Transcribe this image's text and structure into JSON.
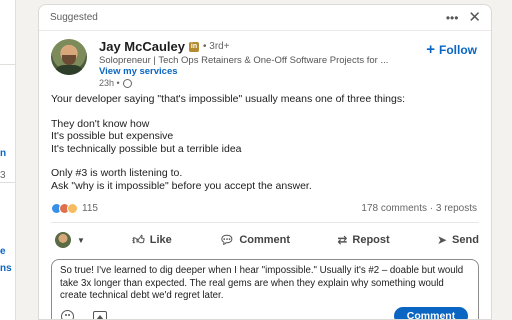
{
  "left_column": {
    "peek_top": "n",
    "peek_mid": "3",
    "peek_lower": "e",
    "peek_bottom": "ns"
  },
  "card": {
    "suggested_label": "Suggested",
    "more_icon": "ellipsis-icon",
    "close_icon": "close-icon"
  },
  "author": {
    "name": "Jay McCauley",
    "badge": "in",
    "degree": "• 3rd+",
    "headline": "Solopreneur | Tech Ops Retainers & One-Off Software Projects for ...",
    "view_services": "View my services",
    "timestamp": "23h •",
    "follow_label": "Follow",
    "follow_prefix": "+"
  },
  "post": {
    "line1": "Your developer saying \"that's impossible\" usually means one of three things:",
    "line2": "They don't know how",
    "line3": "It's possible but expensive",
    "line4": "It's technically possible but a terrible idea",
    "line5": "Only #3 is worth listening to.",
    "line6": "Ask \"why is it impossible\" before you accept the answer."
  },
  "social": {
    "reaction_count": "115",
    "comments_reposts": "178 comments · 3 reposts"
  },
  "actions": {
    "like": "Like",
    "comment": "Comment",
    "repost": "Repost",
    "send": "Send"
  },
  "comment_box": {
    "text": "So true! I've learned to dig deeper when I hear \"impossible.\" Usually it's #2 – doable but would take 3x longer than expected. The real gems are when they explain why something would create technical debt we'd regret later.",
    "submit_label": "Comment"
  },
  "colors": {
    "accent": "#0a66c2",
    "background": "#f3f2ef"
  }
}
